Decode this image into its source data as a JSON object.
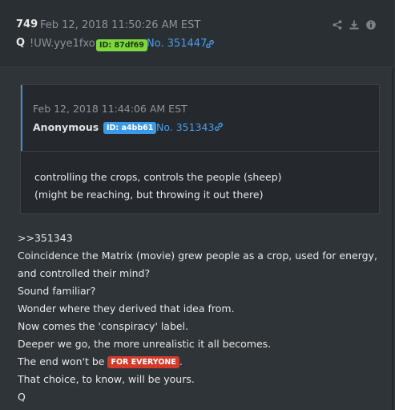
{
  "post": {
    "number": "749",
    "date": "Feb 12, 2018 11:50:26 AM EST",
    "author": "Q",
    "tripcode": "!UW.yye1fxo",
    "id_badge": "ID: 87df69",
    "post_no": "No. 351447",
    "actions": [
      "share-icon",
      "download-icon",
      "info-icon"
    ]
  },
  "quoted": {
    "date": "Feb 12, 2018 11:44:06 AM EST",
    "author": "Anonymous",
    "id_badge": "ID: a4bb61",
    "post_no": "No. 351343",
    "lines": [
      "controlling the crops, controls the people (sheep)",
      "(might be reaching, but throwing it out there)"
    ]
  },
  "body": {
    "reply_ref": ">>351343",
    "line1": "Coincidence the Matrix (movie) grew people as a crop, used for energy,",
    "line2": "and controlled their mind?",
    "line3": "Sound familiar?",
    "line4": "Wonder where they derived that idea from.",
    "line5": "Now comes the 'conspiracy' label.",
    "line6": "Deeper we go, the more unrealistic it all becomes.",
    "line7_prefix": "The end won't be",
    "line7_highlight": "FOR EVERYONE",
    "line7_suffix": ".",
    "line8": "That choice, to know, will be yours.",
    "signature": "Q"
  },
  "colors": {
    "background": "#2f3438",
    "link": "#4a9eea",
    "id_green": "#7dd83f",
    "id_blue": "#3a9ae8",
    "highlight": "#d43a2a"
  }
}
